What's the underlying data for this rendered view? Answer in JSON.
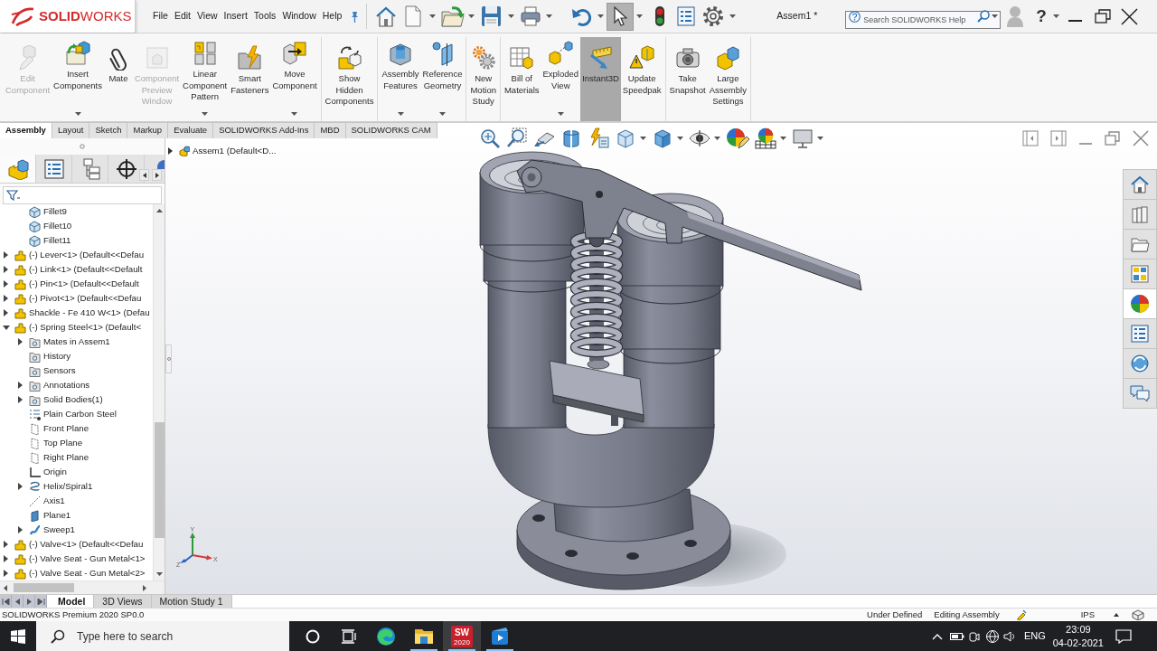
{
  "title_bar": {
    "logo": "**SOLID**WORKS",
    "menu": [
      "File",
      "Edit",
      "View",
      "Insert",
      "Tools",
      "Window",
      "Help"
    ],
    "select_tool_active": true,
    "document_title": "Assem1 *",
    "search": {
      "placeholder": "Search SOLIDWORKS Help"
    },
    "help": "?"
  },
  "ribbon": {
    "groups": [
      [
        {
          "label": "Edit Component",
          "disabled": true,
          "on": false,
          "dropdown": false
        },
        {
          "label": "Insert Components",
          "disabled": false,
          "on": false,
          "dropdown": true
        },
        {
          "label": "Mate",
          "disabled": false,
          "on": false,
          "dropdown": false
        },
        {
          "label": "Component Preview Window",
          "disabled": true,
          "on": false,
          "dropdown": false
        },
        {
          "label": "Linear Component Pattern",
          "disabled": false,
          "on": false,
          "dropdown": true
        },
        {
          "label": "Smart Fasteners",
          "disabled": false,
          "on": false,
          "dropdown": false
        },
        {
          "label": "Move Component",
          "disabled": false,
          "on": false,
          "dropdown": true
        }
      ],
      [
        {
          "label": "Show Hidden Components",
          "disabled": false,
          "on": false,
          "dropdown": false
        }
      ],
      [
        {
          "label": "Assembly Features",
          "disabled": false,
          "on": false,
          "dropdown": true
        },
        {
          "label": "Reference Geometry",
          "disabled": false,
          "on": false,
          "dropdown": true
        }
      ],
      [
        {
          "label": "New Motion Study",
          "disabled": false,
          "on": false,
          "dropdown": false
        }
      ],
      [
        {
          "label": "Bill of Materials",
          "disabled": false,
          "on": false,
          "dropdown": false
        },
        {
          "label": "Exploded View",
          "disabled": false,
          "on": false,
          "dropdown": true
        },
        {
          "label": "Instant3D",
          "disabled": false,
          "on": true,
          "dropdown": false
        },
        {
          "label": "Update Speedpak",
          "disabled": false,
          "on": false,
          "dropdown": false
        }
      ],
      [
        {
          "label": "Take Snapshot",
          "disabled": false,
          "on": false,
          "dropdown": false
        },
        {
          "label": "Large Assembly Settings",
          "disabled": false,
          "on": false,
          "dropdown": false
        }
      ]
    ]
  },
  "command_tabs": [
    {
      "label": "Assembly",
      "selected": true
    },
    {
      "label": "Layout",
      "selected": false
    },
    {
      "label": "Sketch",
      "selected": false
    },
    {
      "label": "Markup",
      "selected": false
    },
    {
      "label": "Evaluate",
      "selected": false
    },
    {
      "label": "SOLIDWORKS Add-Ins",
      "selected": false
    },
    {
      "label": "MBD",
      "selected": false
    },
    {
      "label": "SOLIDWORKS CAM",
      "selected": false
    }
  ],
  "feature_manager": {
    "tabs": [
      {
        "selected": true
      },
      {
        "selected": false
      },
      {
        "selected": false
      },
      {
        "selected": false
      },
      {
        "selected": false
      }
    ],
    "tree": {
      "continued": [
        {
          "label": "Fillet9",
          "kind": "feature"
        },
        {
          "label": "Fillet10",
          "kind": "feature"
        },
        {
          "label": "Fillet11",
          "kind": "feature"
        }
      ],
      "items": [
        {
          "label": "(-) Lever<1> (Default<<Defau",
          "kind": "component",
          "expanded": false
        },
        {
          "label": "(-) Link<1> (Default<<Default",
          "kind": "component",
          "expanded": false
        },
        {
          "label": "(-) Pin<1> (Default<<Default",
          "kind": "component",
          "expanded": false
        },
        {
          "label": "(-) Pivot<1> (Default<<Defau",
          "kind": "component",
          "expanded": false
        },
        {
          "label": "Shackle - Fe 410 W<1> (Defau",
          "kind": "component",
          "expanded": false
        },
        {
          "label": "(-) Spring Steel<1> (Default<",
          "kind": "component",
          "expanded": true,
          "children": [
            {
              "label": "Mates in Assem1",
              "kind": "folder",
              "expanded": false
            },
            {
              "label": "History",
              "kind": "folder"
            },
            {
              "label": "Sensors",
              "kind": "folder"
            },
            {
              "label": "Annotations",
              "kind": "folder",
              "expanded": false
            },
            {
              "label": "Solid Bodies(1)",
              "kind": "folder",
              "expanded": false
            },
            {
              "label": "Plain Carbon Steel",
              "kind": "material"
            },
            {
              "label": "Front Plane",
              "kind": "plane"
            },
            {
              "label": "Top Plane",
              "kind": "plane"
            },
            {
              "label": "Right Plane",
              "kind": "plane"
            },
            {
              "label": "Origin",
              "kind": "origin"
            },
            {
              "label": "Helix/Spiral1",
              "kind": "helix",
              "expanded": false
            },
            {
              "label": "Axis1",
              "kind": "axis"
            },
            {
              "label": "Plane1",
              "kind": "userplane"
            },
            {
              "label": "Sweep1",
              "kind": "sweep",
              "expanded": false
            }
          ]
        },
        {
          "label": "(-) Valve<1> (Default<<Defau",
          "kind": "component",
          "expanded": false
        },
        {
          "label": "(-) Valve Seat - Gun Metal<1>",
          "kind": "component",
          "expanded": false
        },
        {
          "label": "(-) Valve Seat - Gun Metal<2>",
          "kind": "component",
          "expanded": false
        }
      ]
    }
  },
  "graphics_area": {
    "flyout_tree": {
      "label": "Assem1 (Default<D...",
      "expanded": false
    },
    "triad": {
      "x": "X",
      "y": "Y",
      "z": "Z"
    }
  },
  "task_pane": [
    {
      "selected": false
    },
    {
      "selected": false
    },
    {
      "selected": false
    },
    {
      "selected": false
    },
    {
      "selected": true
    },
    {
      "selected": false
    },
    {
      "selected": false
    },
    {
      "selected": false
    }
  ],
  "bottom_tabs": [
    {
      "label": "Model",
      "selected": true
    },
    {
      "label": "3D Views",
      "selected": false
    },
    {
      "label": "Motion Study 1",
      "selected": false
    }
  ],
  "status_bar": {
    "product": "SOLIDWORKS Premium 2020 SP0.0",
    "state": "Under Defined",
    "mode": "Editing Assembly",
    "units": "IPS"
  },
  "taskbar": {
    "search": {
      "placeholder": "Type here to search"
    },
    "apps": [
      {
        "running": false,
        "active": false
      },
      {
        "running": true,
        "active": false
      },
      {
        "running": true,
        "active": true,
        "icon_text": "SW",
        "icon_subtext": "2020"
      },
      {
        "running": true,
        "active": false
      }
    ],
    "language": "ENG",
    "time": "23:09",
    "date": "04-02-2021"
  }
}
